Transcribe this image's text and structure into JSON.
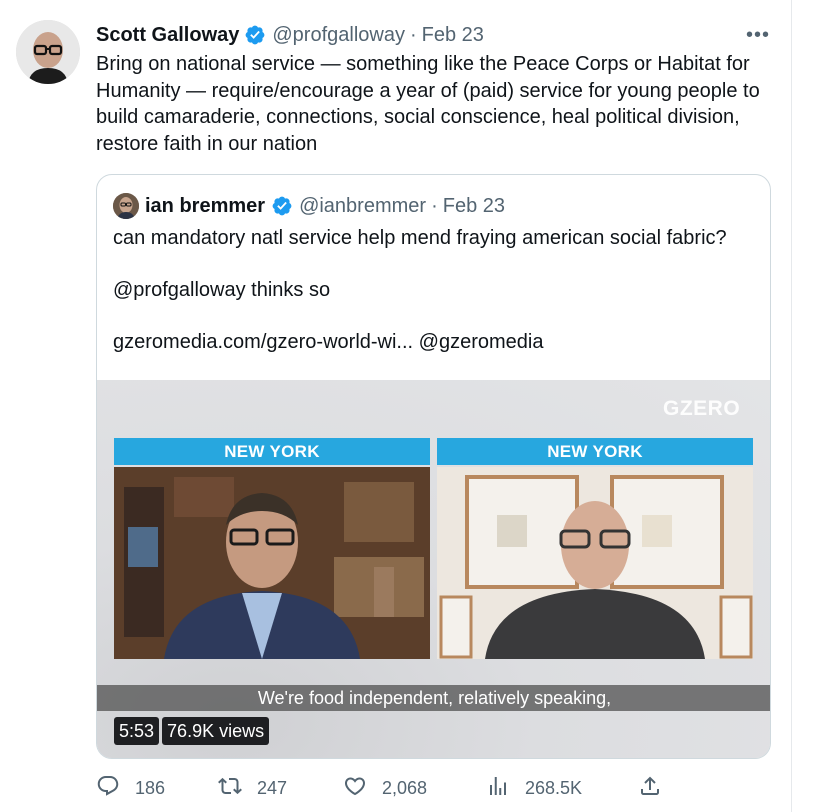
{
  "tweet": {
    "author_name": "Scott Galloway",
    "handle": "@profgalloway",
    "separator": "·",
    "date": "Feb 23",
    "more_label": "•••",
    "text": "Bring on national service — something like the Peace Corps or Habitat for Humanity — require/encourage a year of (paid) service for young people to build camaraderie, connections, social conscience, heal political division, restore faith in our nation"
  },
  "quote": {
    "author_name": "ian bremmer",
    "handle": "@ianbremmer",
    "separator": "·",
    "date": "Feb 23",
    "lines": [
      "can mandatory natl service help mend fraying american social fabric?",
      "@profgalloway thinks so",
      "gzeromedia.com/gzero-world-wi... @gzeromedia"
    ],
    "video": {
      "watermark": "GZERO",
      "left_panel_label": "NEW YORK",
      "right_panel_label": "NEW YORK",
      "caption": "We're food independent, relatively speaking,",
      "duration": "5:53",
      "views": "76.9K views"
    }
  },
  "actions": {
    "replies": "186",
    "retweets": "247",
    "likes": "2,068",
    "views": "268.5K"
  },
  "colors": {
    "verified": "#1d9bf0",
    "secondary_text": "#536471",
    "panel_label": "#27a7df",
    "border": "#cfd9de"
  },
  "icons": [
    "verified-badge-icon",
    "more-icon",
    "reply-icon",
    "retweet-icon",
    "like-icon",
    "views-icon",
    "share-icon"
  ]
}
